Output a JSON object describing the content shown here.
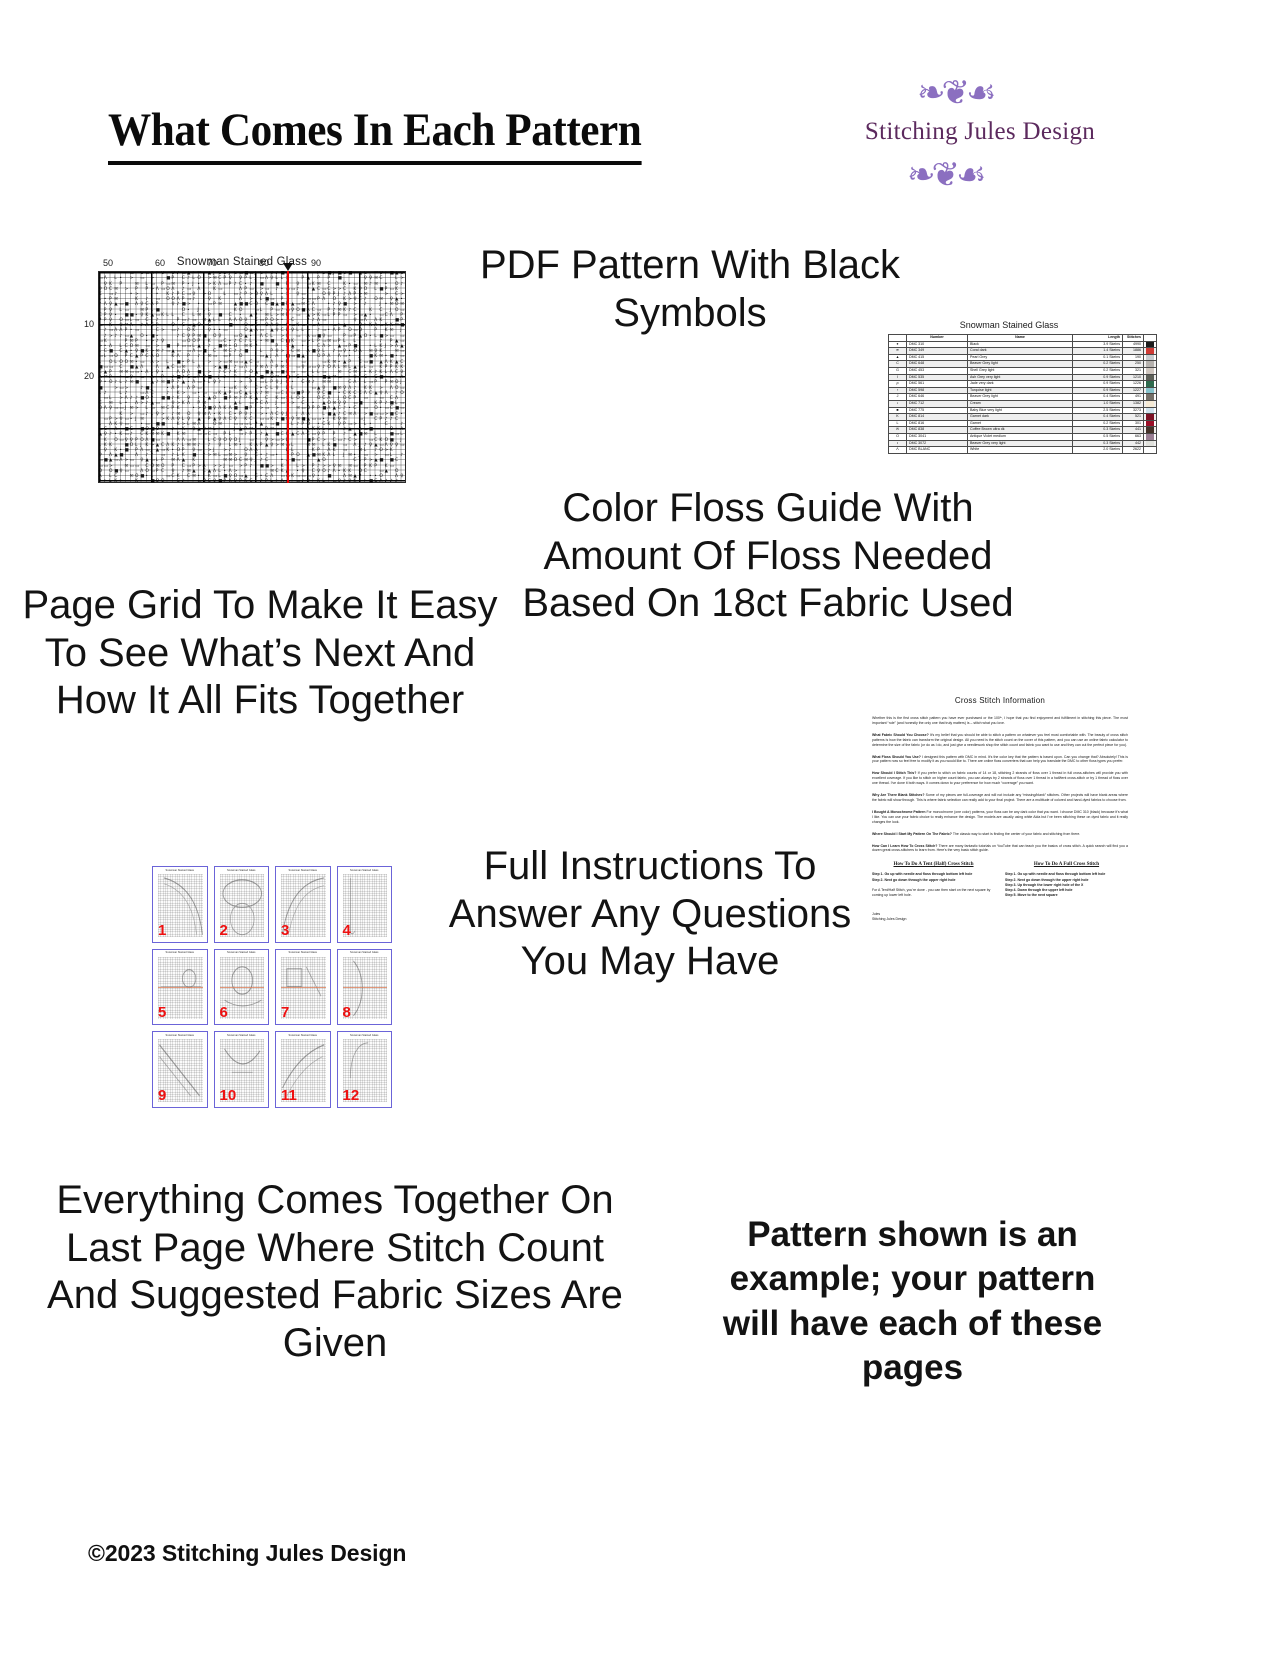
{
  "header": {
    "title": "What Comes In Each Pattern",
    "logo": {
      "name": "Stitching Jules Design",
      "swirl_top": "❧❦☙",
      "swirl_bottom": "❧❦☙",
      "color_text": "#5c2a5e",
      "color_swirl": "#8b6fc0"
    }
  },
  "callouts": {
    "pdf_pattern": "PDF Pattern With Black Symbols",
    "page_grid": "Page Grid To Make It Easy To See What’s Next And How It All Fits Together",
    "floss_guide": "Color Floss Guide With Amount Of Floss Needed Based On 18ct Fabric Used",
    "instructions": "Full Instructions To Answer Any Questions You May Have",
    "last_page": "Everything Comes Together On Last Page Where Stitch Count And Suggested Fabric Sizes Are Given",
    "note": "Pattern shown is an example; your pattern will have each of these pages"
  },
  "footer": {
    "copyright": "©2023 Stitching Jules Design"
  },
  "chart_preview": {
    "title": "Snowman Stained Glass",
    "column_labels": [
      "50",
      "60",
      "70",
      "80",
      "90"
    ],
    "row_labels": [
      "10",
      "20"
    ],
    "center_marker_color": "#ee0000"
  },
  "floss_table": {
    "title": "Snowman Stained Glass",
    "columns": [
      "",
      "Number",
      "Name",
      "Length",
      "Stitches",
      ""
    ],
    "rows": [
      {
        "symbol": "●",
        "number": "DMC   310",
        "name": "Black",
        "length": "3.9 Skeins",
        "stitches": "4990",
        "swatch": "#1c1c1c"
      },
      {
        "symbol": "≋",
        "number": "DMC   349",
        "name": "Coral dark",
        "length": "1.4 Skeins",
        "stitches": "1886",
        "swatch": "#cf3b35"
      },
      {
        "symbol": "▲",
        "number": "DMC   415",
        "name": "Pearl Grey",
        "length": "0.1 Skeins",
        "stitches": "190",
        "swatch": "#c8ccd0"
      },
      {
        "symbol": "C",
        "number": "DMC   648",
        "name": "Beaver Grey light",
        "length": "0.2 Skeins",
        "stitches": "250",
        "swatch": "#b5b1ad"
      },
      {
        "symbol": "G",
        "number": "DMC   453",
        "name": "Shell Grey light",
        "length": "0.2 Skeins",
        "stitches": "321",
        "swatch": "#cfc6bf"
      },
      {
        "symbol": "I",
        "number": "DMC   535",
        "name": "Ash Grey very light",
        "length": "0.9 Skeins",
        "stitches": "1210",
        "swatch": "#5e6058"
      },
      {
        "symbol": "ρ",
        "number": "DMC   561",
        "name": "Jade very dark",
        "length": "0.9 Skeins",
        "stitches": "1226",
        "swatch": "#2e6b4e"
      },
      {
        "symbol": "♀",
        "number": "DMC   598",
        "name": "Turqoise light",
        "length": "0.9 Skeins",
        "stitches": "1227",
        "swatch": "#86c3cc"
      },
      {
        "symbol": "J",
        "number": "DMC   646",
        "name": "Beaver Grey light",
        "length": "0.4 Skeins",
        "stitches": "491",
        "swatch": "#757069"
      },
      {
        "symbol": "♪",
        "number": "DMC   712",
        "name": "Cream",
        "length": "1.0 Skeins",
        "stitches": "1382",
        "swatch": "#f5ead5"
      },
      {
        "symbol": "■",
        "number": "DMC   775",
        "name": "Baby Blue very light",
        "length": "2.5 Skeins",
        "stitches": "3273",
        "swatch": "#cfe2ee"
      },
      {
        "symbol": "K",
        "number": "DMC   814",
        "name": "Garnet dark",
        "length": "0.4 Skeins",
        "stitches": "521",
        "swatch": "#7d1024"
      },
      {
        "symbol": "L",
        "number": "DMC   816",
        "name": "Garnet",
        "length": "0.2 Skeins",
        "stitches": "301",
        "swatch": "#9b0f28"
      },
      {
        "symbol": "✉",
        "number": "DMC   838",
        "name": "Coffee Brown ultra dk",
        "length": "0.3 Skeins",
        "stitches": "441",
        "swatch": "#453229"
      },
      {
        "symbol": "O",
        "number": "DMC   3041",
        "name": "Antique Violet medium",
        "length": "0.5 Skeins",
        "stitches": "663",
        "swatch": "#9a7e93"
      },
      {
        "symbol": "•",
        "number": "DMC   3072",
        "name": "Beaver Grey very light",
        "length": "0.3 Skeins",
        "stitches": "442",
        "swatch": "#e0e1dc"
      },
      {
        "symbol": "Λ",
        "number": "DMC   BLANC",
        "name": "White",
        "length": "2.0 Skeins",
        "stitches": "2622",
        "swatch": "#ffffff"
      }
    ]
  },
  "instructions_page": {
    "title": "Cross Stitch Information",
    "intro": "Whether this is the first cross stitch pattern you have ever purchased or the 100ᵗʰ, I hope that you find enjoyment and fulfillment in stitching this piece. The most important “rule” (and honestly the only one that truly matters) is – stitch what you love.",
    "intro_emphasis": "stitch what you love.",
    "sections": [
      {
        "heading": "What Fabric Should You Choose?",
        "body": " It’s my belief that you should be able to stitch a pattern on whatever you feel most comfortable with. The beauty of cross stitch patterns is how the fabric can transform the original design. All you need is the stitch count on the cover of this pattern, and you can use an online fabric calculator to determine the size of the fabric (or do as I do, and just give a needlework shop the stitch count and fabric you want to use and they can cut the perfect piece for you)."
      },
      {
        "heading": "What Floss Should You Use?",
        "body": " I designed this pattern with DMC in mind. It’s the color key that the pattern is based upon. Can you change that? Absolutely! This is your pattern now so feel free to modify it as you would like to. There are online floss converters that can help you translate the DMC to other floss types you prefer."
      },
      {
        "heading": "How Should I Stitch This?",
        "body": " If you prefer to stitch on fabric counts of 14 or 18, stitching 2 strands of floss over 1 thread in full cross-stitches will provide you with excellent coverage. If you like to stitch on higher count fabric, you can always try 2 strands of floss over 1 thread in a half/tent cross-stitch or try 1 thread of floss over one thread. I’ve done it both ways. It comes down to your preference for how much “coverage” you want."
      },
      {
        "heading": "Why Are There Blank Stitches?",
        "body": " Some of my pieces are full-coverage and will not include any “missing/blank” stitches. Other projects will have blank areas where the fabric will show through. This is where fabric selection can really add to your final project. There are a multitude of colored and hand-dyed fabrics to choose from."
      },
      {
        "heading": "I Bought A Monochrome Pattern",
        "body": " For monochrome (one color) patterns, your floss can be any dark color that you want. I choose DMC 310 (black) because it’s what I like. You can use your fabric choice to really enhance the design. The models are usually using white Aida but I’ve been stitching these on dyed fabric and it really changes the look."
      },
      {
        "heading": "Where Should I Start My Pattern On The Fabric?",
        "body": " The classic way to start is finding the center of your fabric and stitching from there."
      },
      {
        "heading": "How Can I Learn How To Cross Stitch?",
        "body": " There are many fantastic tutorials on YouTube that can teach you the basics of cross stitch. A quick search will find you a dozen great cross-stitchers to learn from. Here’s the very basic stitch guide."
      }
    ],
    "half_stitch": {
      "heading": "How To Do A Tent (Half) Cross Stitch",
      "steps": [
        "Step 1. Go up with needle and floss through bottom left hole",
        "Step 2. Next go down through the upper right hole"
      ],
      "note": "For A Tent/Half Stitch, you’re done - you can then start on the next square by coming up lower left hole."
    },
    "full_stitch": {
      "heading": "How To Do A Full Cross Stitch",
      "steps": [
        "Step 1. Go up with needle and floss through bottom left hole",
        "Step 2. Next go down through the upper right hole",
        "Step 3. Up through the lower right hole of the X",
        "Step 4. Down through the upper left hole",
        "Step 5. Move to the next square"
      ]
    },
    "signature": [
      "Jules",
      "Stitching Jules Design"
    ]
  },
  "page_grid": {
    "thumb_title": "Snowman Stained Glass",
    "numbers": [
      "1",
      "2",
      "3",
      "4",
      "5",
      "6",
      "7",
      "8",
      "9",
      "10",
      "11",
      "12"
    ],
    "number_color": "#ee1111",
    "border_color": "#6b64d8"
  }
}
